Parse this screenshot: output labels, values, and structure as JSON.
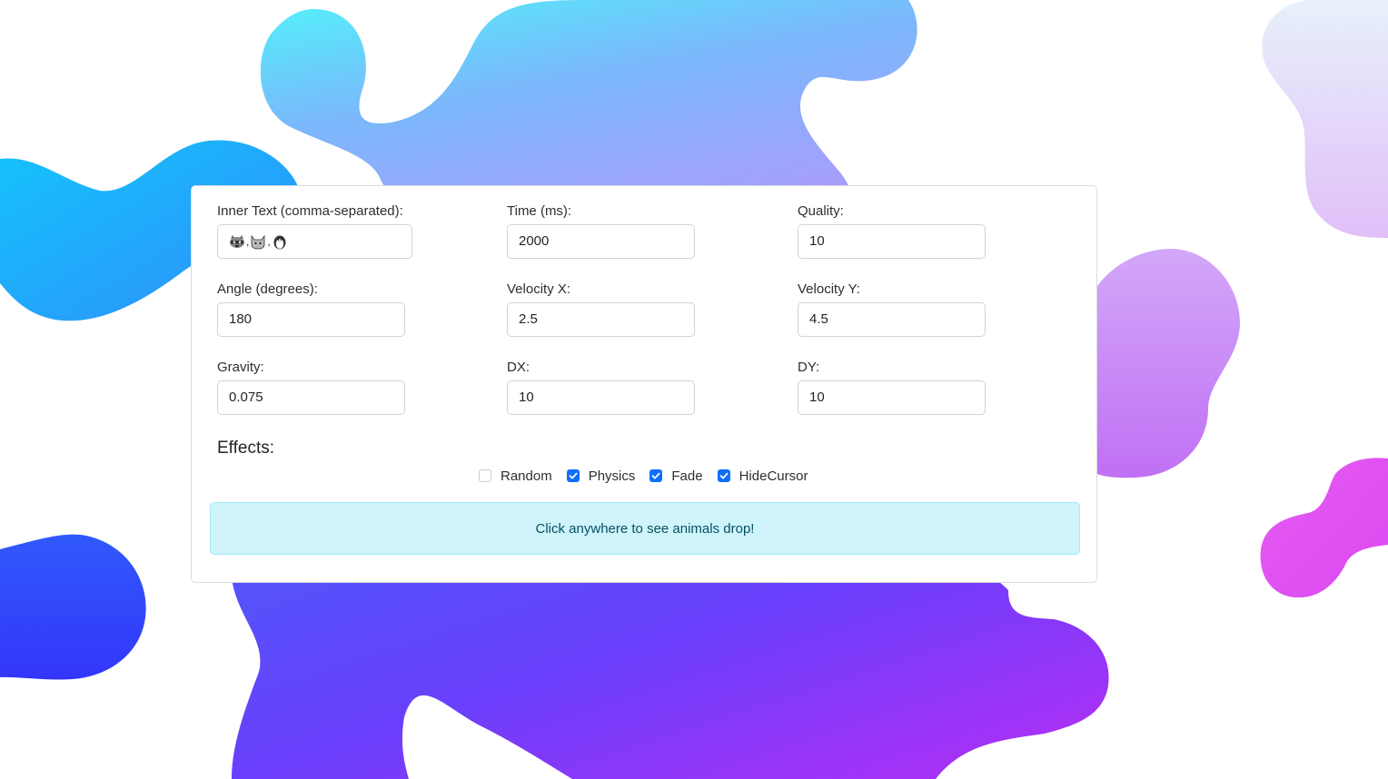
{
  "form": {
    "inner_text": {
      "label": "Inner Text (comma-separated):",
      "value_icons": [
        "raccoon-icon",
        "cat-icon",
        "penguin-icon"
      ]
    },
    "time": {
      "label": "Time (ms):",
      "value": "2000"
    },
    "quality": {
      "label": "Quality:",
      "value": "10"
    },
    "angle": {
      "label": "Angle (degrees):",
      "value": "180"
    },
    "velocity_x": {
      "label": "Velocity X:",
      "value": "2.5"
    },
    "velocity_y": {
      "label": "Velocity Y:",
      "value": "4.5"
    },
    "gravity": {
      "label": "Gravity:",
      "value": "0.075"
    },
    "dx": {
      "label": "DX:",
      "value": "10"
    },
    "dy": {
      "label": "DY:",
      "value": "10"
    }
  },
  "effects": {
    "title": "Effects:",
    "options": [
      {
        "label": "Random",
        "checked": false
      },
      {
        "label": "Physics",
        "checked": true
      },
      {
        "label": "Fade",
        "checked": true
      },
      {
        "label": "HideCursor",
        "checked": true
      }
    ]
  },
  "alert": {
    "text": "Click anywhere to see animals drop!"
  },
  "colors": {
    "accent": "#0d6efd",
    "alert_bg": "#cff4fc",
    "alert_text": "#055160"
  }
}
